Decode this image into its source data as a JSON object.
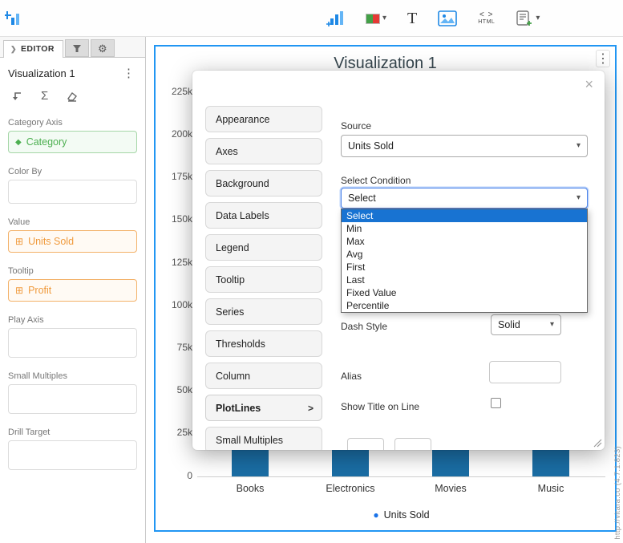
{
  "page": {
    "watermark": "http://vitara.co (4.7.1.823)"
  },
  "icons": {
    "caret": "▾",
    "kebab": "⋮",
    "close": "×",
    "text_tool": "T",
    "code": "< >",
    "html": "HTML",
    "sigma": "Σ",
    "diamond": "◆",
    "grid": "⊞",
    "dot": "●",
    "editor_chevron": "❯",
    "gear": "⚙",
    "active_chevron": ">"
  },
  "sidebar": {
    "editor_tab_label": "EDITOR",
    "title": "Visualization 1",
    "fields": [
      {
        "label": "Category Axis",
        "chip": "Category"
      },
      {
        "label": "Color By"
      },
      {
        "label": "Value",
        "chip": "Units Sold"
      },
      {
        "label": "Tooltip",
        "chip": "Profit"
      },
      {
        "label": "Play Axis"
      },
      {
        "label": "Small Multiples"
      },
      {
        "label": "Drill Target"
      }
    ]
  },
  "chart": {
    "title": "Visualization 1",
    "y_ticks": [
      "225k",
      "200k",
      "175k",
      "150k",
      "125k",
      "100k",
      "75k",
      "50k",
      "25k",
      "0"
    ],
    "categories": [
      "Books",
      "Electronics",
      "Movies",
      "Music"
    ],
    "legend_label": "Units Sold",
    "bar_color": "#1a6da4",
    "accent_color": "#2196f3"
  },
  "chart_data": {
    "type": "bar",
    "categories": [
      "Books",
      "Electronics",
      "Movies",
      "Music"
    ],
    "series": [
      {
        "name": "Units Sold",
        "values": [
          null,
          null,
          null,
          null
        ]
      }
    ],
    "title": "Visualization 1",
    "ylim": [
      0,
      225000
    ],
    "y_tick_labels": [
      "0",
      "25k",
      "50k",
      "75k",
      "100k",
      "125k",
      "150k",
      "175k",
      "200k",
      "225k"
    ],
    "legend_position": "bottom"
  },
  "modal": {
    "tabs": [
      "Appearance",
      "Axes",
      "Background",
      "Data Labels",
      "Legend",
      "Tooltip",
      "Series",
      "Thresholds",
      "Column",
      "PlotLines",
      "Small Multiples"
    ],
    "active_tab": "PlotLines",
    "form": {
      "source_label": "Source",
      "source_value": "Units Sold",
      "condition_label": "Select Condition",
      "condition_value": "Select",
      "options": [
        "Select",
        "Min",
        "Max",
        "Avg",
        "First",
        "Last",
        "Fixed Value",
        "Percentile"
      ],
      "selected_option": "Select",
      "dash_label": "Dash Style",
      "dash_value": "Solid",
      "alias_label": "Alias",
      "show_title_label": "Show Title on Line",
      "show_title_checked": false
    }
  }
}
